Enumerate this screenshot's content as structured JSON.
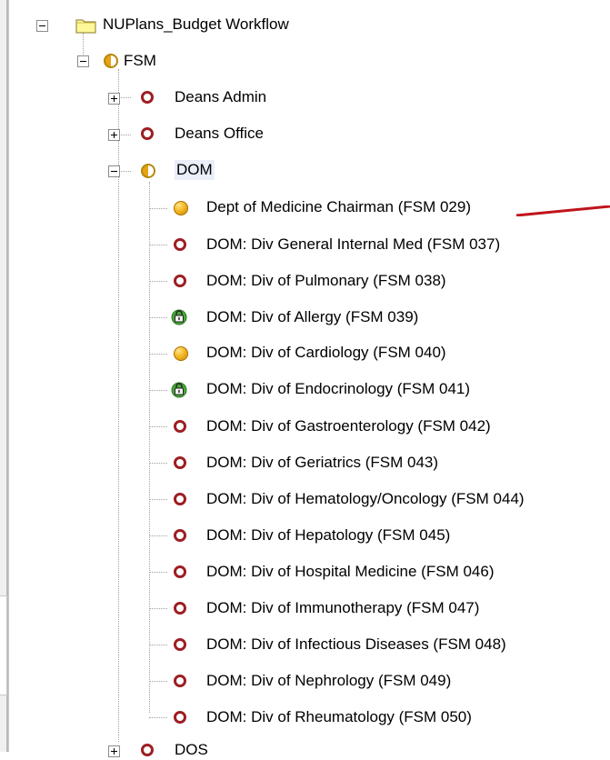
{
  "tree": {
    "root": {
      "label": "NUPlans_Budget Workflow",
      "icon": "folder-icon"
    },
    "fsm": {
      "label": "FSM",
      "icon": "half-status-icon"
    },
    "level2": [
      {
        "label": "Deans Admin",
        "icon": "red-ring-icon",
        "expander": "+"
      },
      {
        "label": "Deans Office",
        "icon": "red-ring-icon",
        "expander": "+"
      },
      {
        "label": "DOM",
        "icon": "half-status-icon",
        "expander": "-"
      }
    ],
    "dom_children": [
      {
        "label": "Dept of Medicine Chairman (FSM 029)",
        "icon": "gold-ball-icon"
      },
      {
        "label": "DOM: Div General Internal Med (FSM 037)",
        "icon": "red-ring-icon"
      },
      {
        "label": "DOM: Div of Pulmonary (FSM 038)",
        "icon": "red-ring-icon"
      },
      {
        "label": "DOM: Div of Allergy (FSM 039)",
        "icon": "lock-icon"
      },
      {
        "label": "DOM: Div of Cardiology (FSM 040)",
        "icon": "gold-ball-icon"
      },
      {
        "label": "DOM: Div of Endocrinology (FSM 041)",
        "icon": "lock-icon"
      },
      {
        "label": "DOM: Div of Gastroenterology (FSM 042)",
        "icon": "red-ring-icon"
      },
      {
        "label": "DOM: Div of Geriatrics (FSM 043)",
        "icon": "red-ring-icon"
      },
      {
        "label": "DOM: Div of Hematology/Oncology (FSM 044)",
        "icon": "red-ring-icon"
      },
      {
        "label": "DOM: Div of Hepatology (FSM 045)",
        "icon": "red-ring-icon"
      },
      {
        "label": "DOM: Div of Hospital Medicine (FSM 046)",
        "icon": "red-ring-icon"
      },
      {
        "label": "DOM: Div of Immunotherapy (FSM 047)",
        "icon": "red-ring-icon"
      },
      {
        "label": "DOM: Div of Infectious Diseases (FSM 048)",
        "icon": "red-ring-icon"
      },
      {
        "label": "DOM: Div of Nephrology (FSM 049)",
        "icon": "red-ring-icon"
      },
      {
        "label": "DOM: Div of Rheumatology (FSM 050)",
        "icon": "red-ring-icon"
      }
    ],
    "partial_next": {
      "label": "DOS",
      "icon": "red-ring-icon",
      "expander": "+"
    }
  },
  "annotation": {
    "icon": "red-arrow-icon",
    "color": "#c0141b"
  },
  "colors": {
    "not_started": "#9d1e23",
    "in_progress": "#f2b51d",
    "locked": "#3a8f2e"
  }
}
